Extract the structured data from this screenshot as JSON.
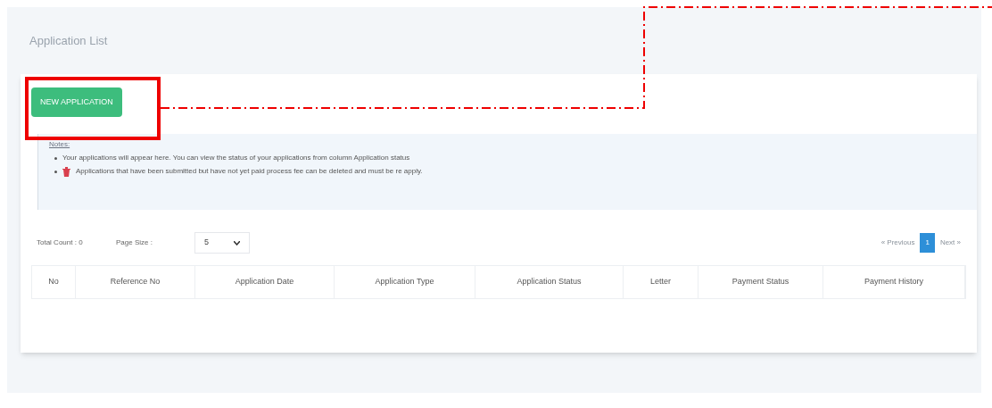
{
  "page_title": "Application List",
  "new_button": "NEW APPLICATION",
  "notes": {
    "heading": "Notes:",
    "items": [
      {
        "kind": "text",
        "text": "Your applications will appear here. You can view the status of your applications from column Application status"
      },
      {
        "kind": "trash",
        "text": "Applications that have been submitted but have not yet paid process fee can be deleted and must be re apply."
      }
    ]
  },
  "total_count": "Total Count : 0",
  "page_size": {
    "label": "Page Size :",
    "value": "5"
  },
  "pagination": {
    "previous": "« Previous",
    "pages": [
      {
        "label": "1",
        "selected": true
      }
    ],
    "next": "Next »"
  },
  "table": {
    "columns": [
      "No",
      "Reference No",
      "Application Date",
      "Application Type",
      "Application Status",
      "Letter",
      "Payment Status",
      "Payment History"
    ]
  }
}
